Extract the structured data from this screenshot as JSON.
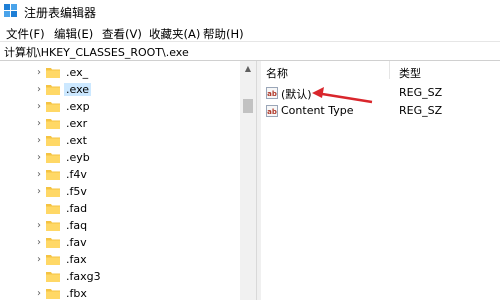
{
  "window": {
    "title": "注册表编辑器"
  },
  "menu": [
    {
      "label": "文件(F)"
    },
    {
      "label": "编辑(E)"
    },
    {
      "label": "查看(V)"
    },
    {
      "label": "收藏夹(A)"
    },
    {
      "label": "帮助(H)"
    }
  ],
  "address": {
    "path": "计算机\\HKEY_CLASSES_ROOT\\.exe"
  },
  "tree": {
    "items": [
      {
        "label": ".ex_",
        "expandable": true
      },
      {
        "label": ".exe",
        "expandable": true,
        "selected": true
      },
      {
        "label": ".exp",
        "expandable": true
      },
      {
        "label": ".exr",
        "expandable": true
      },
      {
        "label": ".ext",
        "expandable": true
      },
      {
        "label": ".eyb",
        "expandable": true
      },
      {
        "label": ".f4v",
        "expandable": true
      },
      {
        "label": ".f5v",
        "expandable": true
      },
      {
        "label": ".fad",
        "expandable": false
      },
      {
        "label": ".faq",
        "expandable": true
      },
      {
        "label": ".fav",
        "expandable": true
      },
      {
        "label": ".fax",
        "expandable": true
      },
      {
        "label": ".faxg3",
        "expandable": false
      },
      {
        "label": ".fbx",
        "expandable": true
      }
    ]
  },
  "values_pane": {
    "columns": {
      "name": "名称",
      "type": "类型"
    },
    "rows": [
      {
        "icon": "string-value-icon",
        "icon_text": "ab",
        "name": "(默认)",
        "type": "REG_SZ"
      },
      {
        "icon": "string-value-icon",
        "icon_text": "ab",
        "name": "Content Type",
        "type": "REG_SZ"
      }
    ]
  },
  "annotation": {
    "color": "#d9262c"
  }
}
